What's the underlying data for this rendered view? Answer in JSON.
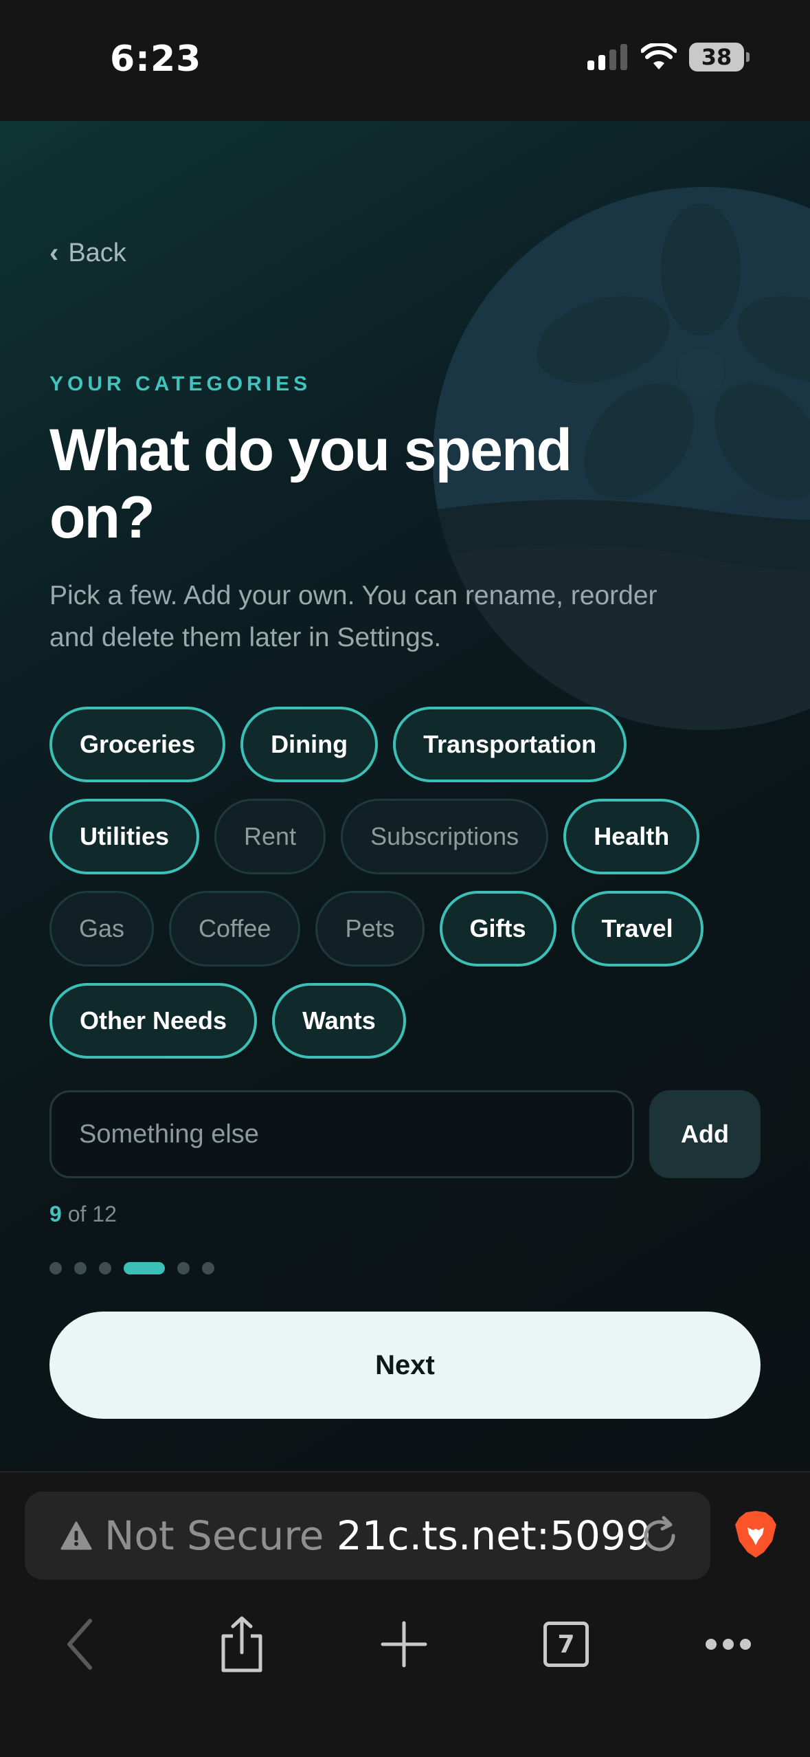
{
  "status_bar": {
    "time": "6:23",
    "battery": "38",
    "icons": [
      "signal-icon",
      "wifi-icon",
      "battery-icon"
    ]
  },
  "header": {
    "back_label": "Back",
    "eyebrow": "YOUR CATEGORIES",
    "title": "What do you spend on?",
    "subtitle": "Pick a few. Add your own. You can rename, reorder and delete them later in Settings."
  },
  "categories": [
    {
      "label": "Groceries",
      "selected": true
    },
    {
      "label": "Dining",
      "selected": true
    },
    {
      "label": "Transportation",
      "selected": true
    },
    {
      "label": "Utilities",
      "selected": true
    },
    {
      "label": "Rent",
      "selected": false
    },
    {
      "label": "Subscriptions",
      "selected": false
    },
    {
      "label": "Health",
      "selected": true
    },
    {
      "label": "Gas",
      "selected": false
    },
    {
      "label": "Coffee",
      "selected": false
    },
    {
      "label": "Pets",
      "selected": false
    },
    {
      "label": "Gifts",
      "selected": true
    },
    {
      "label": "Travel",
      "selected": true
    },
    {
      "label": "Other Needs",
      "selected": true
    },
    {
      "label": "Wants",
      "selected": true
    }
  ],
  "custom": {
    "placeholder": "Something else",
    "value": "",
    "add_label": "Add"
  },
  "counter": {
    "selected": "9",
    "total_text": "of 12"
  },
  "progress": {
    "steps": 6,
    "current": 4
  },
  "next_label": "Next",
  "browser": {
    "security": "Not Secure",
    "url_fragment": "21c.ts.net:5099",
    "tab_count": "7"
  },
  "colors": {
    "accent": "#3cbfb6",
    "cta_background": "#e9f6f3",
    "brave_orange": "#fb542b"
  }
}
